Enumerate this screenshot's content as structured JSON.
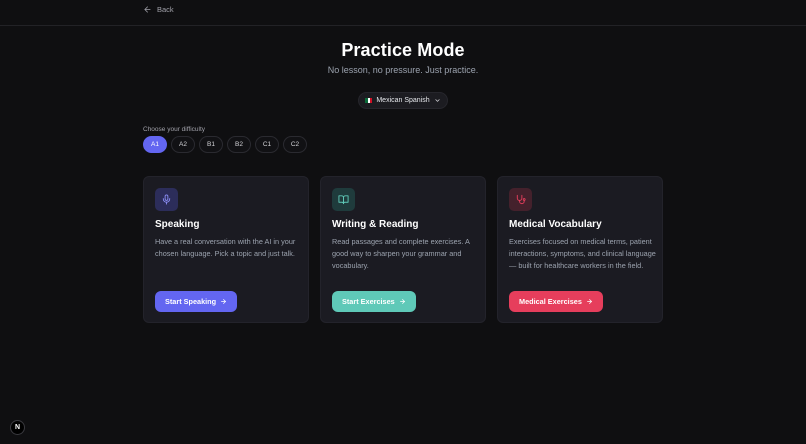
{
  "nav": {
    "back_label": "Back"
  },
  "header": {
    "title": "Practice Mode",
    "subtitle": "No lesson, no pressure. Just practice."
  },
  "language": {
    "selected": "Mexican Spanish"
  },
  "difficulty": {
    "label": "Choose your difficulty",
    "levels": [
      "A1",
      "A2",
      "B1",
      "B2",
      "C1",
      "C2"
    ],
    "selected": "A1"
  },
  "cards": [
    {
      "title": "Speaking",
      "description": "Have a real conversation with the AI in your chosen language. Pick a topic and just talk.",
      "button": "Start Speaking",
      "icon": "microphone-icon",
      "accent": "#6366f1"
    },
    {
      "title": "Writing & Reading",
      "description": "Read passages and complete exercises. A good way to sharpen your grammar and vocabulary.",
      "button": "Start Exercises",
      "icon": "book-open-icon",
      "accent": "#5fc9b8"
    },
    {
      "title": "Medical Vocabulary",
      "description": "Exercises focused on medical terms, patient interactions, symptoms, and clinical language — built for healthcare workers in the field.",
      "button": "Medical Exercises",
      "icon": "stethoscope-icon",
      "accent": "#e63e5c"
    }
  ],
  "badge": {
    "label": "N"
  }
}
